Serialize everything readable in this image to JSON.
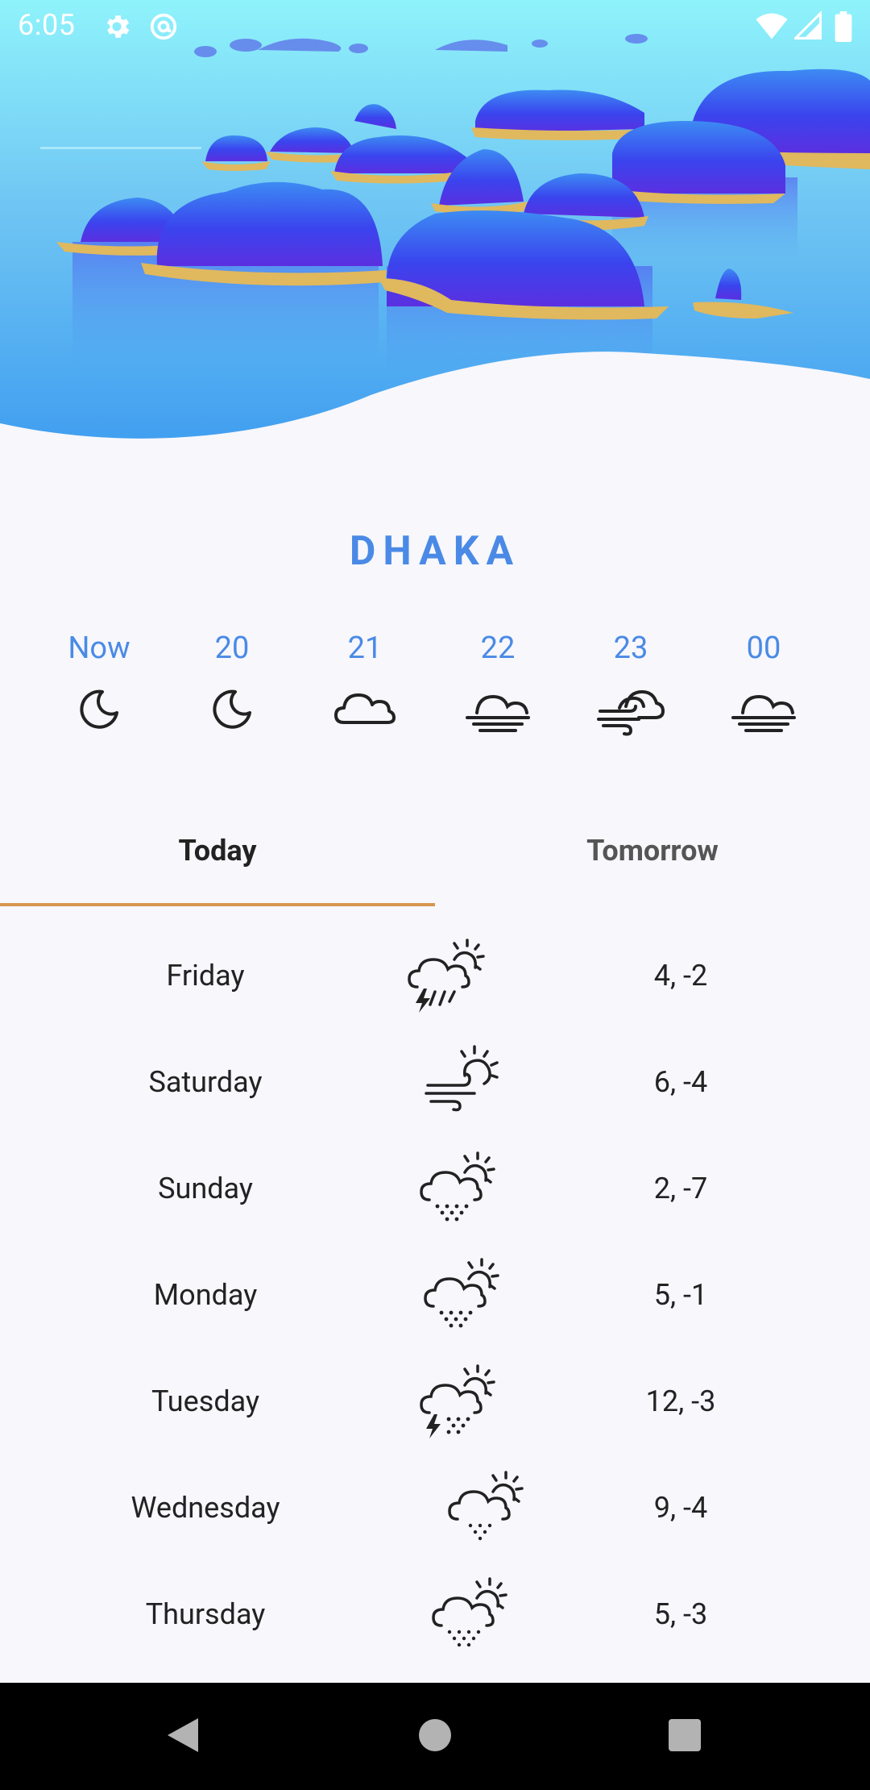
{
  "status_bar": {
    "time": "6:05",
    "icons": [
      "gear-icon",
      "at-sign-icon",
      "wifi-icon",
      "signal-icon",
      "battery-icon"
    ]
  },
  "city": "DHAKA",
  "hourly": [
    {
      "label": "Now",
      "icon": "moon-icon"
    },
    {
      "label": "20",
      "icon": "moon-icon"
    },
    {
      "label": "21",
      "icon": "cloud-icon"
    },
    {
      "label": "22",
      "icon": "fog-cloud-icon"
    },
    {
      "label": "23",
      "icon": "wind-cloudy-icon"
    },
    {
      "label": "00",
      "icon": "fog-cloud-icon"
    }
  ],
  "tabs": {
    "today": "Today",
    "tomorrow": "Tomorrow"
  },
  "daily": [
    {
      "day": "Friday",
      "temp": "4, -2",
      "icon": "thunder-rain-sun-icon"
    },
    {
      "day": "Saturday",
      "temp": "6, -4",
      "icon": "wind-sun-icon"
    },
    {
      "day": "Sunday",
      "temp": "2, -7",
      "icon": "rain-sun-icon"
    },
    {
      "day": "Monday",
      "temp": "5, -1",
      "icon": "rain-sun-icon"
    },
    {
      "day": "Tuesday",
      "temp": "12, -3",
      "icon": "thunder-rain-sun-icon"
    },
    {
      "day": "Wednesday",
      "temp": "9, -4",
      "icon": "rain-sun-icon"
    },
    {
      "day": "Thursday",
      "temp": "5, -3",
      "icon": "rain-sun-icon"
    }
  ],
  "colors": {
    "accent": "#4a8ae6",
    "tab_indicator": "#d6974e",
    "background": "#f7f7fc"
  }
}
